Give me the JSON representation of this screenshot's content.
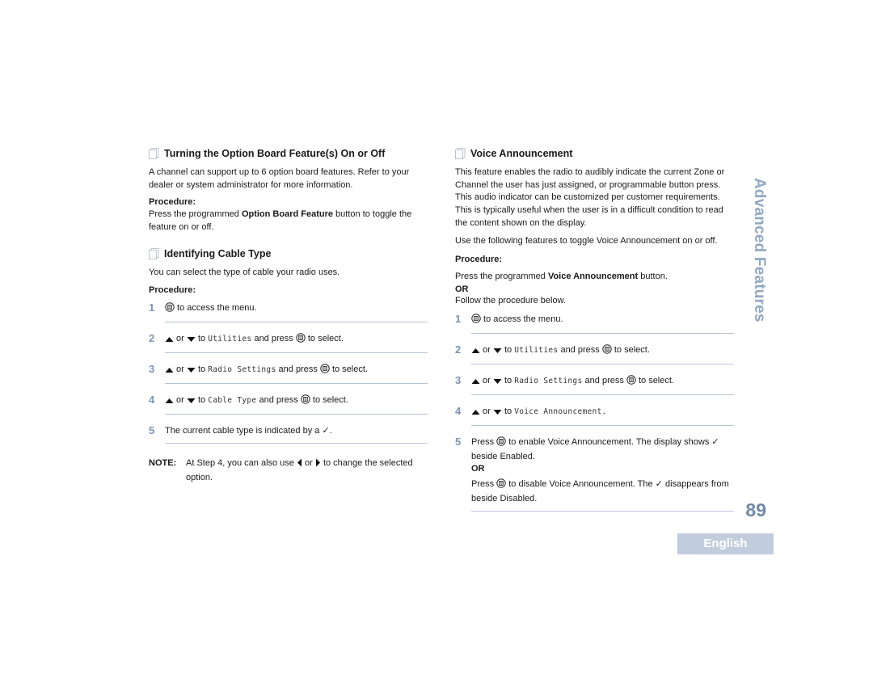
{
  "left": {
    "section1": {
      "title": "Turning the Option Board Feature(s) On or Off",
      "intro": "A channel can support up to 6 option board features. Refer to your dealer or system administrator for more information.",
      "procedure_label": "Procedure:",
      "press_pre": "Press the programmed ",
      "press_bold": "Option Board Feature",
      "press_post": " button to toggle the feature on or off."
    },
    "section2": {
      "title": "Identifying Cable Type",
      "intro": "You can select the type of cable your radio uses.",
      "procedure_label": "Procedure:",
      "steps": [
        {
          "num": "1",
          "post": " to access the menu."
        },
        {
          "num": "2",
          "or": " or ",
          "to": " to ",
          "item": "Utilities",
          "press": " and press ",
          "post": " to select."
        },
        {
          "num": "3",
          "or": " or ",
          "to": " to ",
          "item": "Radio Settings",
          "press": " and press ",
          "post": " to select."
        },
        {
          "num": "4",
          "or": " or ",
          "to": " to ",
          "item": "Cable Type",
          "press": " and press ",
          "post": " to select."
        },
        {
          "num": "5",
          "text": "The current cable type is indicated by a ",
          "check": "✓",
          "post": "."
        }
      ],
      "note": {
        "label": "NOTE:",
        "pre": "At Step 4, you can also use ",
        "or": " or ",
        "post": " to change the selected option."
      }
    }
  },
  "right": {
    "section": {
      "title": "Voice Announcement",
      "intro": "This feature enables the radio to audibly indicate the current Zone or Channel the user has just assigned, or programmable button press. This audio indicator can be customized per customer requirements. This is typically useful when the user is in a difficult condition to read the content shown on the display.",
      "intro2": "Use the following features to toggle Voice Announcement on or off.",
      "procedure_label": "Procedure:",
      "press_pre": "Press the programmed ",
      "press_bold": "Voice Announcement",
      "press_post": " button.",
      "or_label": "OR",
      "follow": "Follow the procedure below.",
      "steps": [
        {
          "num": "1",
          "post": " to access the menu."
        },
        {
          "num": "2",
          "or": " or ",
          "to": " to ",
          "item": "Utilities",
          "press": " and press ",
          "post": " to select."
        },
        {
          "num": "3",
          "or": " or ",
          "to": " to ",
          "item": "Radio Settings",
          "press": " and press ",
          "post": " to select."
        },
        {
          "num": "4",
          "or": " or ",
          "to": " to ",
          "item": "Voice Announcement."
        },
        {
          "num": "5",
          "a_pre": "Press ",
          "a_post": " to enable Voice Announcement. The display shows ",
          "check": "✓",
          "a_end": " beside Enabled.",
          "or_label": "OR",
          "b_pre": "Press ",
          "b_post": " to disable Voice Announcement. The ",
          "b_end": " disappears from beside Disabled."
        }
      ]
    }
  },
  "side_title": "Advanced Features",
  "page_number": "89",
  "language_tab": "English",
  "colors": {
    "accent": "#90a8c3",
    "page_number": "#6f8aa6",
    "language_tab_bg": "#c1cddc",
    "step_number": "#7a96b4"
  }
}
